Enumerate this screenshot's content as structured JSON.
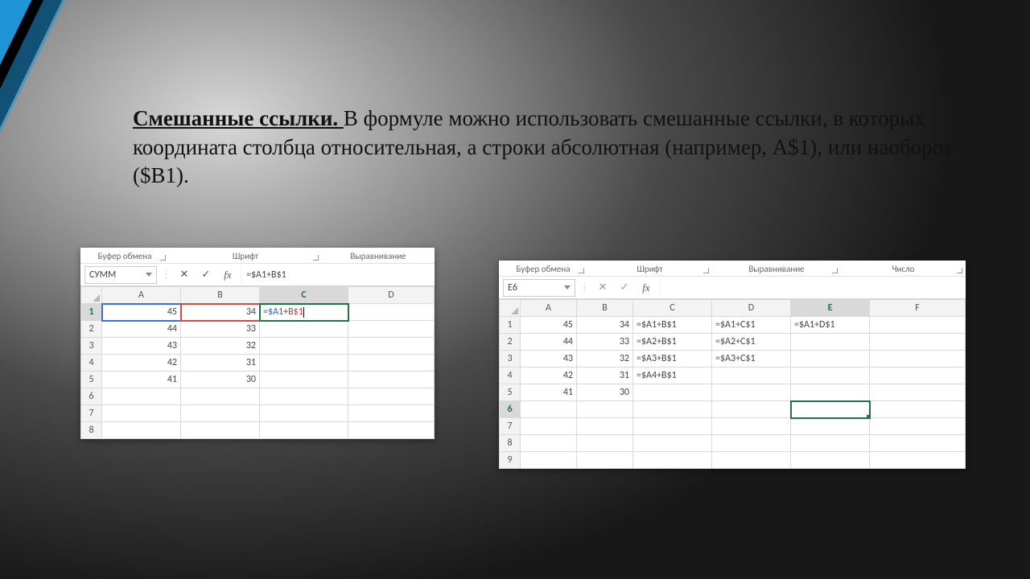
{
  "text": {
    "title": "Смешанные ссылки. ",
    "body": "В формуле можно использовать смешанные ссылки, в которых координата столбца относительная, а строки абсолютная (например, А$1), или наоборот ($В1)."
  },
  "excel1": {
    "groups": {
      "g1": "Буфер обмена",
      "g2": "Шрифт",
      "g3": "Выравнивание"
    },
    "namebox": "СУММ",
    "icons": {
      "cancel": "✕",
      "enter": "✓",
      "fx": "fx"
    },
    "fcontent": "=$A1+B$1",
    "cols": [
      "A",
      "B",
      "C",
      "D"
    ],
    "rows": [
      "1",
      "2",
      "3",
      "4",
      "5",
      "6",
      "7",
      "8"
    ],
    "a": [
      "45",
      "44",
      "43",
      "42",
      "41"
    ],
    "b": [
      "34",
      "33",
      "32",
      "31",
      "30"
    ],
    "c1_pre": "=",
    "c1_r1": "$A1",
    "c1_op": "+",
    "c1_r2": "B$1"
  },
  "excel2": {
    "groups": {
      "g1": "Буфер обмена",
      "g2": "Шрифт",
      "g3": "Выравнивание",
      "g4": "Число"
    },
    "namebox": "E6",
    "icons": {
      "cancel": "✕",
      "enter": "✓",
      "fx": "fx"
    },
    "fcontent": "",
    "cols": [
      "A",
      "B",
      "C",
      "D",
      "E",
      "F"
    ],
    "rows": [
      "1",
      "2",
      "3",
      "4",
      "5",
      "6",
      "7",
      "8",
      "9"
    ],
    "a": [
      "45",
      "44",
      "43",
      "42",
      "41"
    ],
    "b": [
      "34",
      "33",
      "32",
      "31",
      "30"
    ],
    "c": [
      "=$A1+B$1",
      "=$A2+B$1",
      "=$A3+B$1",
      "=$A4+B$1"
    ],
    "d": [
      "=$A1+C$1",
      "=$A2+C$1",
      "=$A3+C$1"
    ],
    "e": [
      "=$A1+D$1"
    ]
  }
}
